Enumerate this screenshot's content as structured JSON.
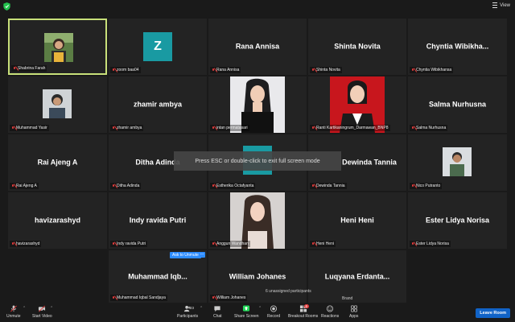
{
  "topbar": {
    "view_label": "View"
  },
  "tiles": {
    "t1": {
      "label": "Shabrina Farah"
    },
    "t2": {
      "avatar": "Z",
      "label": "zoom baa04",
      "avatar_color": "#199aa2"
    },
    "t3": {
      "name": "Rana Annisa",
      "label": "Rana Annisa"
    },
    "t4": {
      "name": "Shinta Novita",
      "label": "Shinta Novita"
    },
    "t5": {
      "name": "Chyntia  Wibikha...",
      "label": "Chyntia Wibikhansa"
    },
    "t6": {
      "label": "Muhammad Yasir"
    },
    "t7": {
      "name": "zhamir ambya",
      "label": "zhamir ambya"
    },
    "t8": {
      "label": "intan permatasari"
    },
    "t9": {
      "label": "Ranti Kartikaningrum_Darmawan_BNP8"
    },
    "t10": {
      "name": "Salma Nurhusna",
      "label": "Salma Nurhusna"
    },
    "t11": {
      "name": "Rai Ajeng A",
      "label": "Rai Ajeng A"
    },
    "t12": {
      "name": "Ditha Adinda",
      "label": "Ditha Adinda"
    },
    "t13": {
      "label": "Estherika Octafyanta"
    },
    "t14": {
      "name": "Dewinda Tannia",
      "label": "Dewinda Tannia"
    },
    "t15": {
      "label": "Nico Putranto"
    },
    "t16": {
      "name": "havizarashyd",
      "label": "havizarashyd"
    },
    "t17": {
      "name": "Indy ravida Putri",
      "label": "Indy ravida Putri"
    },
    "t18": {
      "label": "Anggun Wandhan"
    },
    "t19": {
      "name": "Heni Heni",
      "label": "Heni Heni"
    },
    "t20": {
      "name": "Ester Lidya Norisa",
      "label": "Ester Lidya Norisa"
    },
    "t21": {
      "name": "Muhammad  Iqb...",
      "label": "Muhammad Iqbal Sandjaya"
    },
    "t22": {
      "name": "William Johanes",
      "label": "William Johanes"
    },
    "t23": {
      "name": "Luqyana  Erdanta...",
      "label": "Brand"
    }
  },
  "ask_to_unmute": "Ask to Unmute",
  "more_dots": "...",
  "toast": "Press ESC or double-click to exit full screen mode",
  "unassigned": "6 unassigned participants",
  "toolbar": {
    "unmute": "Unmute",
    "start_video": "Start Video",
    "participants": "Participants",
    "participants_count": "23",
    "chat": "Chat",
    "share_screen": "Share Screen",
    "record": "Record",
    "breakout_rooms": "Breakout Rooms",
    "breakout_badge": "6",
    "reactions": "Reactions",
    "apps": "Apps",
    "leave": "Leave Room"
  },
  "colors": {
    "active_border": "#c8e07a",
    "accent_blue": "#2d8cff",
    "share_green": "#23d959",
    "leave_blue": "#1163c7"
  }
}
